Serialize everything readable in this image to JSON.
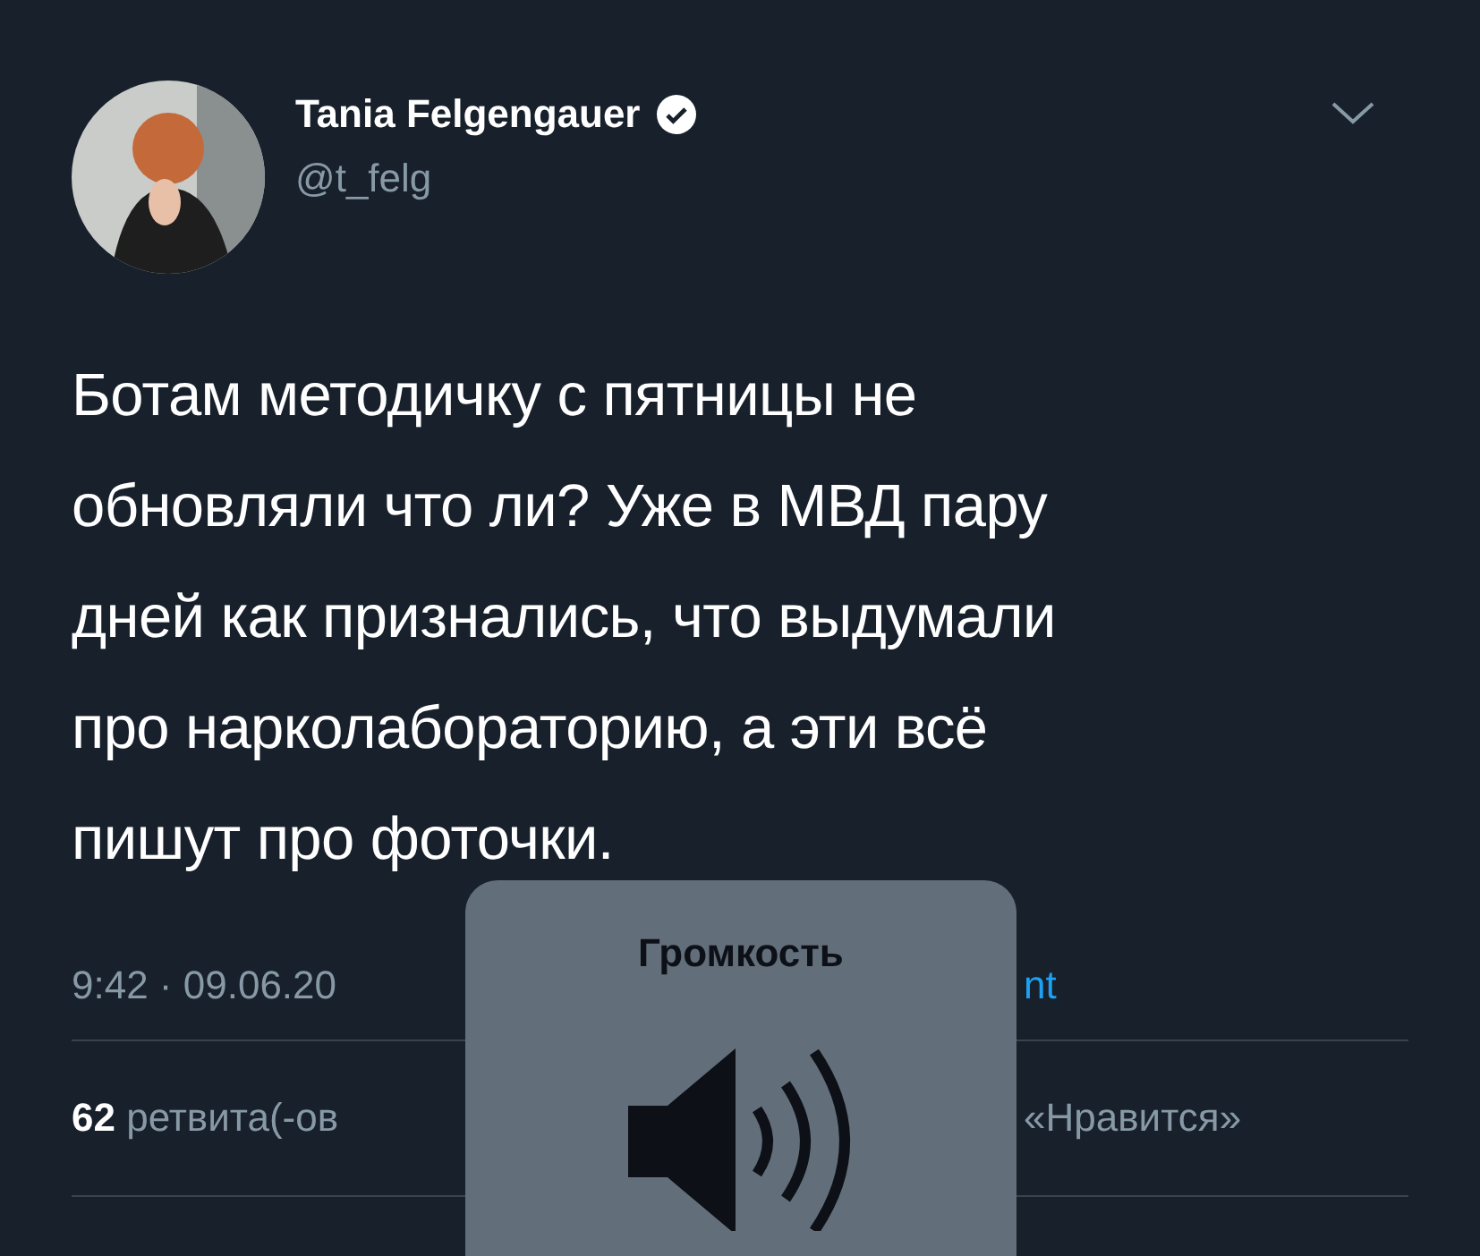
{
  "tweet": {
    "author": {
      "name": "Tania Felgengauer",
      "verified": true,
      "handle": "@t_felg"
    },
    "text_lines": [
      "Ботам методичку с пятницы не",
      "обновляли что ли? Уже в МВД пару",
      "дней как признались, что выдумали",
      "про нарколабораторию, а эти всё",
      "пишут про фоточки."
    ],
    "timestamp": "9:42 · 09.06.20",
    "source": "nt",
    "stats": {
      "count": "62",
      "label": "ретвита(-ов",
      "trailing": "«Нравится»"
    }
  },
  "volume_overlay": {
    "title": "Громкость"
  }
}
